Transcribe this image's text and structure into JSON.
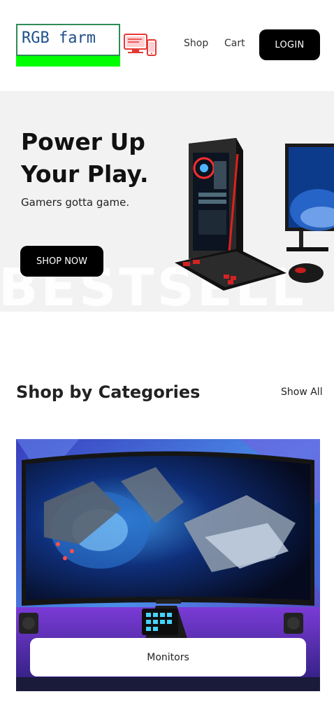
{
  "header": {
    "logo_text": "RGB farm",
    "logo_icon": "devices-icon",
    "nav": {
      "shop": "Shop",
      "cart": "Cart"
    },
    "login_label": "LOGIN"
  },
  "hero": {
    "title": "Power Up Your Play.",
    "subtitle": "Gamers gotta game.",
    "cta_label": "SHOP NOW",
    "background_text": "BESTSELL"
  },
  "categories": {
    "title": "Shop by Categories",
    "show_all_label": "Show All",
    "items": [
      {
        "label": "Monitors",
        "image": "curved-monitor-image"
      }
    ]
  },
  "colors": {
    "accent": "#000000",
    "logo_green": "#00ff00",
    "logo_text": "#1f4f8a",
    "devices_red": "#e53935",
    "hero_bg": "#f2f2f2"
  }
}
